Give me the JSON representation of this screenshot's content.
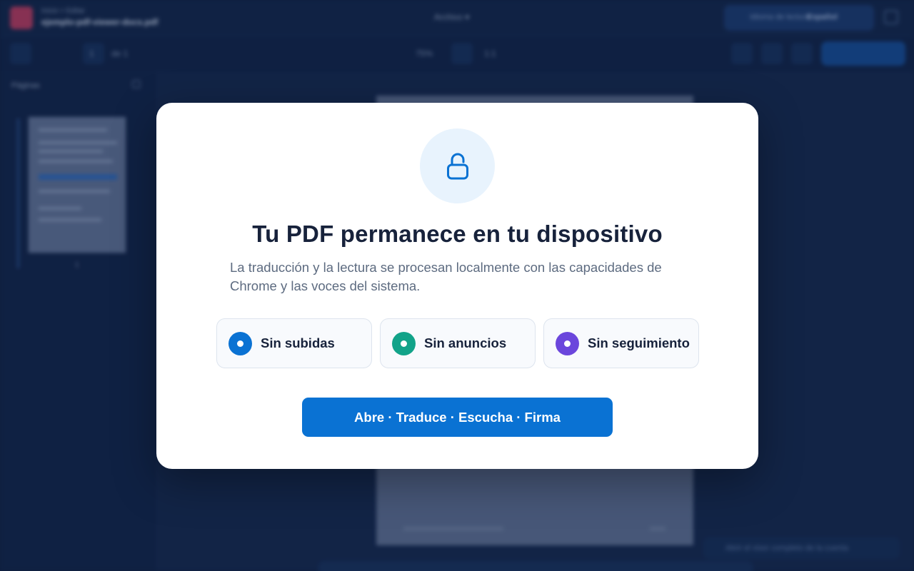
{
  "background": {
    "breadcrumb": "Inicio > Editar",
    "filename": "ejemplo-pdf-viewer-docs.pdf",
    "center_menu": "Archivo ▾",
    "language_label": "Idioma de lectura",
    "language_value": "Español",
    "toolbar": {
      "page_current": "1",
      "page_total": "de 1",
      "zoom": "75%",
      "fit": "1:1"
    },
    "sidebar_title": "Páginas",
    "thumb_number": "1",
    "toast_text": "Abrir el visor completo de la cuenta"
  },
  "modal": {
    "icon": "lock-icon",
    "title": "Tu PDF permanece en tu dispositivo",
    "subtitle": "La traducción y la lectura se procesan localmente con las capacidades de Chrome y las voces del sistema.",
    "features": [
      {
        "label": "Sin subidas",
        "color": "#0a72d3"
      },
      {
        "label": "Sin anuncios",
        "color": "#12a389"
      },
      {
        "label": "Sin seguimiento",
        "color": "#6b46dc"
      }
    ],
    "cta_label": "Abre · Traduce · Escucha · Firma"
  },
  "colors": {
    "accent": "#0a72d3",
    "lock_bg": "#e8f3fd",
    "title": "#17223b",
    "subtitle": "#5d6b80"
  }
}
